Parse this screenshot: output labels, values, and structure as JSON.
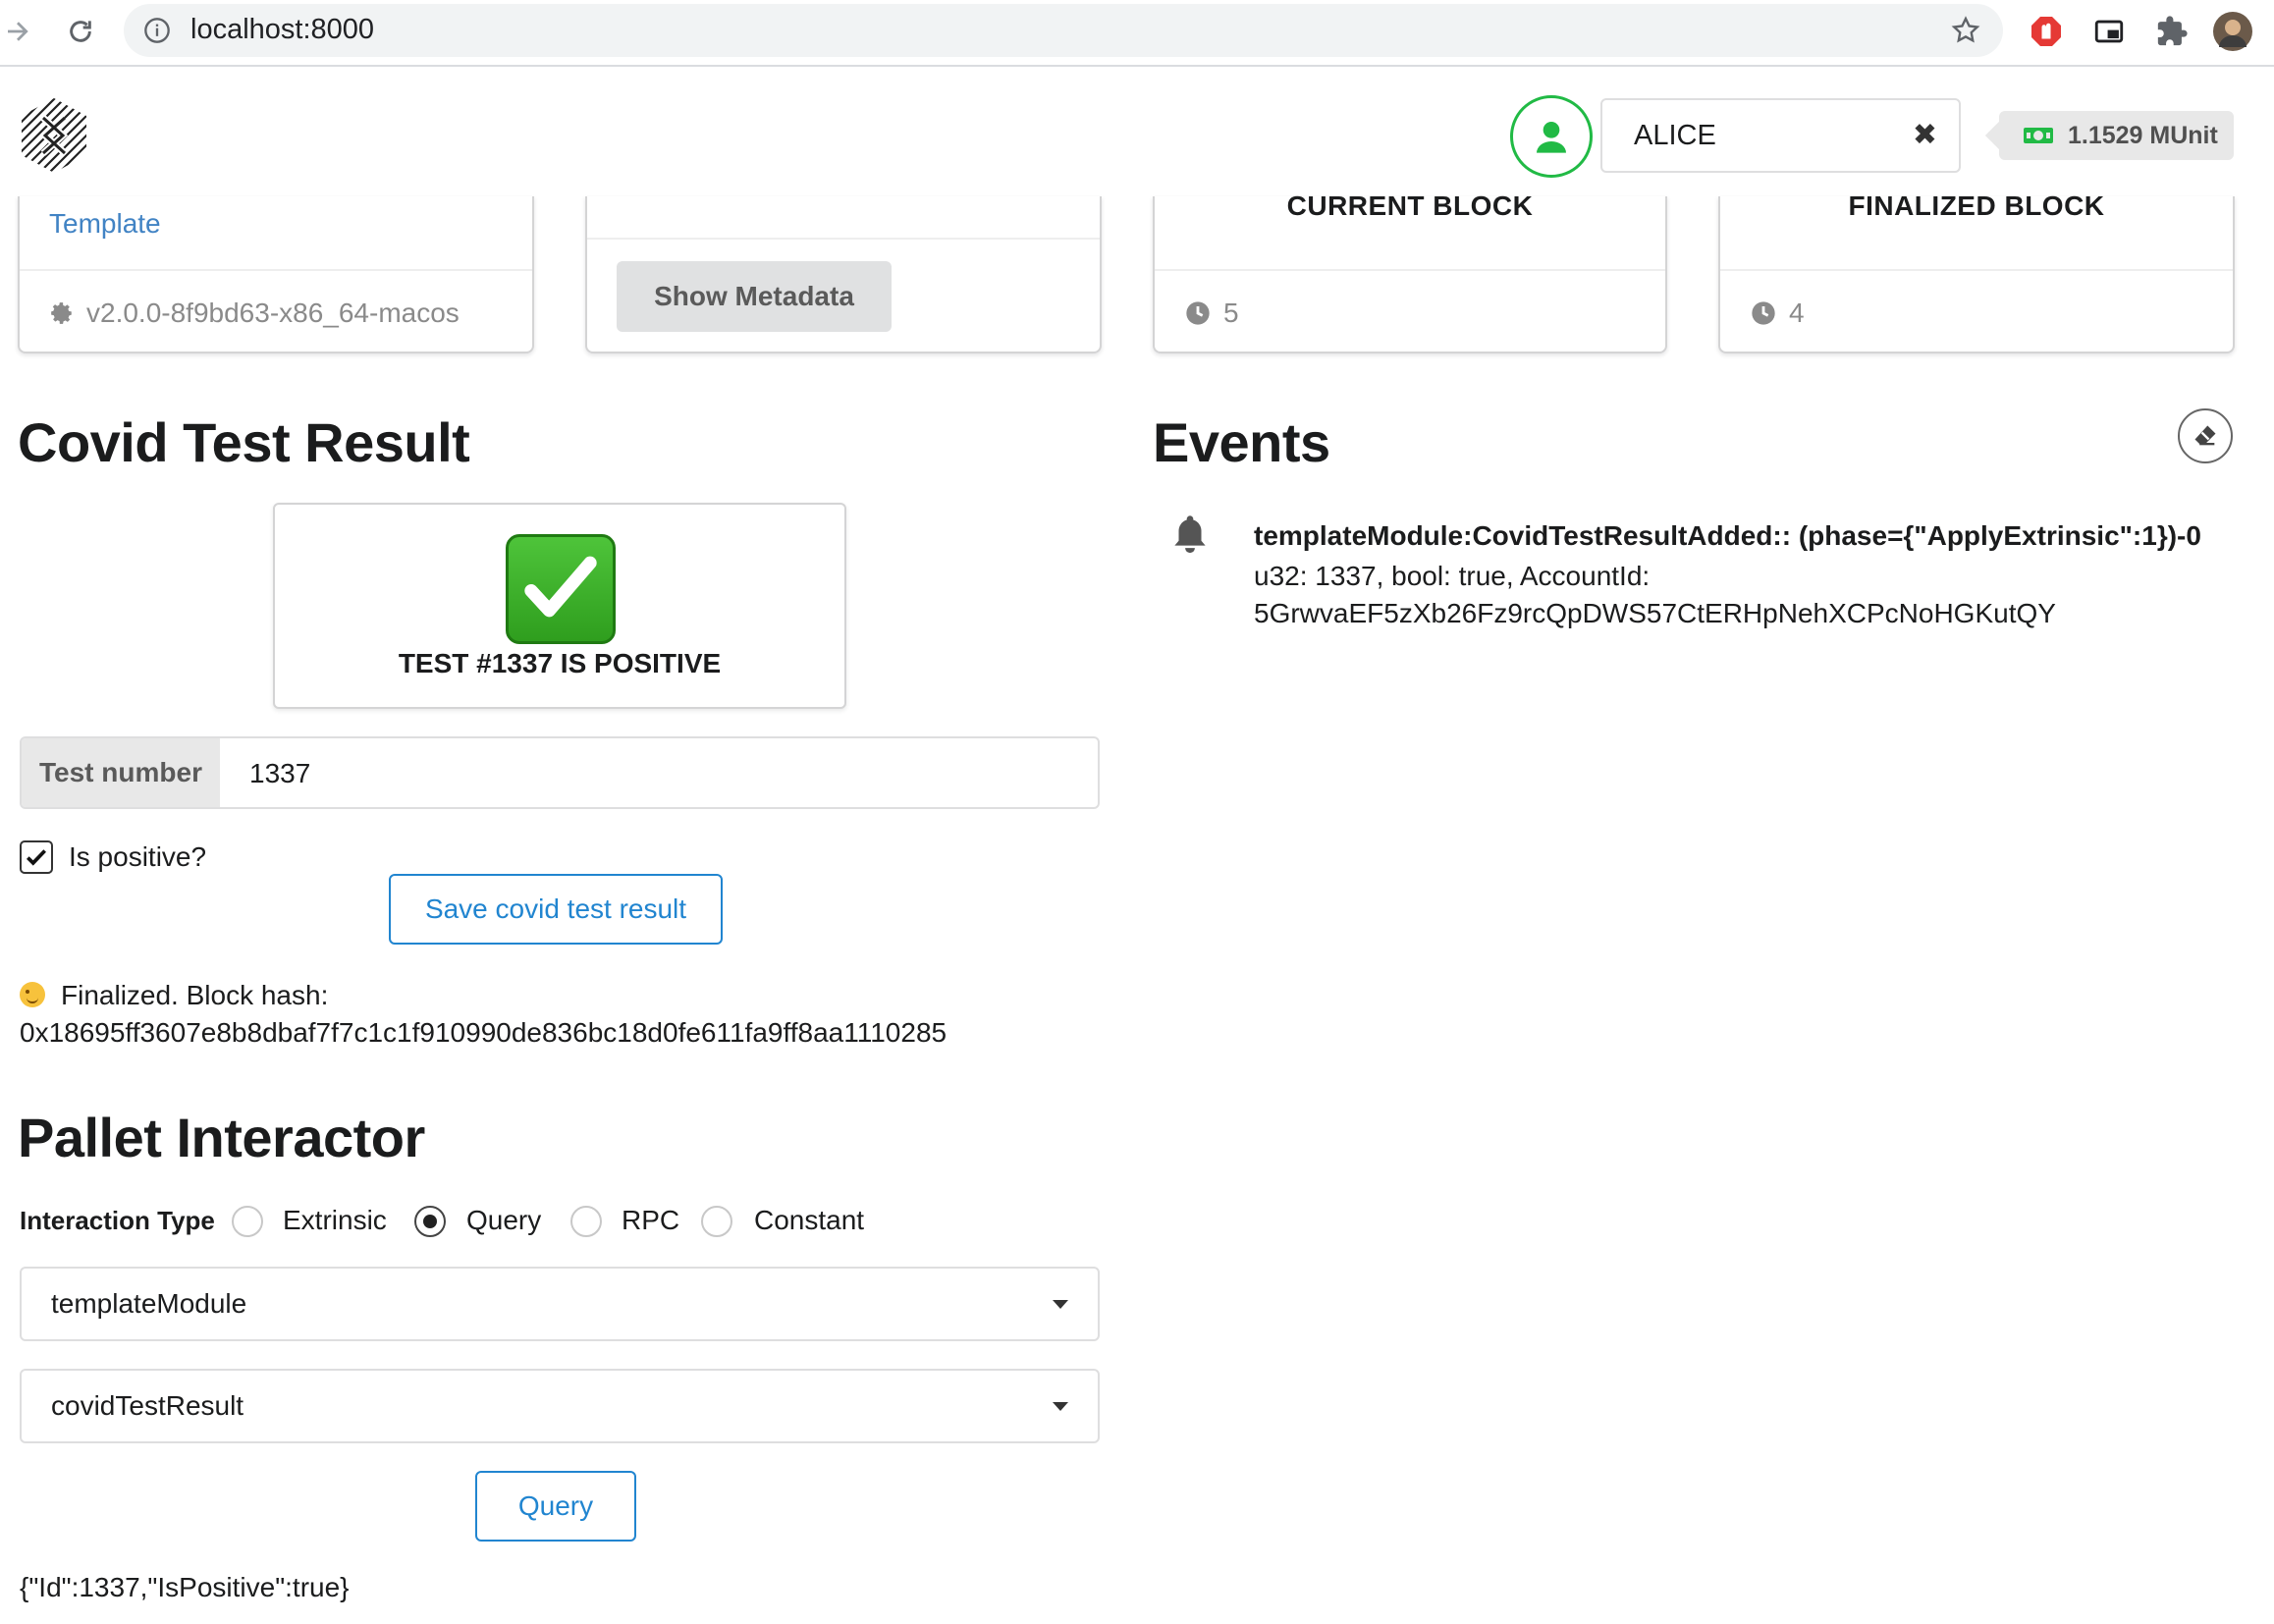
{
  "browser": {
    "url": "localhost:8000"
  },
  "header": {
    "account_name": "ALICE",
    "clear_symbol": "✖",
    "balance": "1.1529 MUnit"
  },
  "cards": {
    "node_link": "Template",
    "node_version": "v2.0.0-8f9bd63-x86_64-macos",
    "metadata_button": "Show Metadata",
    "current_block_title": "CURRENT BLOCK",
    "current_block_value": "5",
    "finalized_block_title": "FINALIZED BLOCK",
    "finalized_block_value": "4"
  },
  "covid": {
    "title": "Covid Test Result",
    "result_text": "TEST #1337 IS POSITIVE",
    "test_number_label": "Test number",
    "test_number_value": "1337",
    "is_positive_label": "Is positive?",
    "is_positive_checked": true,
    "save_button": "Save covid test result",
    "status_line1": "Finalized. Block hash:",
    "status_line2": "0x18695ff3607e8b8dbaf7f7c1c1f910990de836bc18d0fe611fa9ff8aa1110285"
  },
  "events": {
    "title": "Events",
    "items": [
      {
        "title": "templateModule:CovidTestResultAdded:: (phase={\"ApplyExtrinsic\":1})-0",
        "line1": "u32: 1337, bool: true, AccountId:",
        "line2": "5GrwvaEF5zXb26Fz9rcQpDWS57CtERHpNehXCPcNoHGKutQY"
      }
    ]
  },
  "pallet": {
    "title": "Pallet Interactor",
    "interaction_label": "Interaction Type",
    "options": [
      "Extrinsic",
      "Query",
      "RPC",
      "Constant"
    ],
    "selected_option": "Query",
    "pallet_select": "templateModule",
    "callable_select": "covidTestResult",
    "query_button": "Query",
    "result": "{\"Id\":1337,\"IsPositive\":true}"
  },
  "colors": {
    "accent_blue": "#2185d0",
    "link_blue": "#4183c4",
    "account_green": "#21ba45",
    "check_green": "#3cb52a"
  }
}
